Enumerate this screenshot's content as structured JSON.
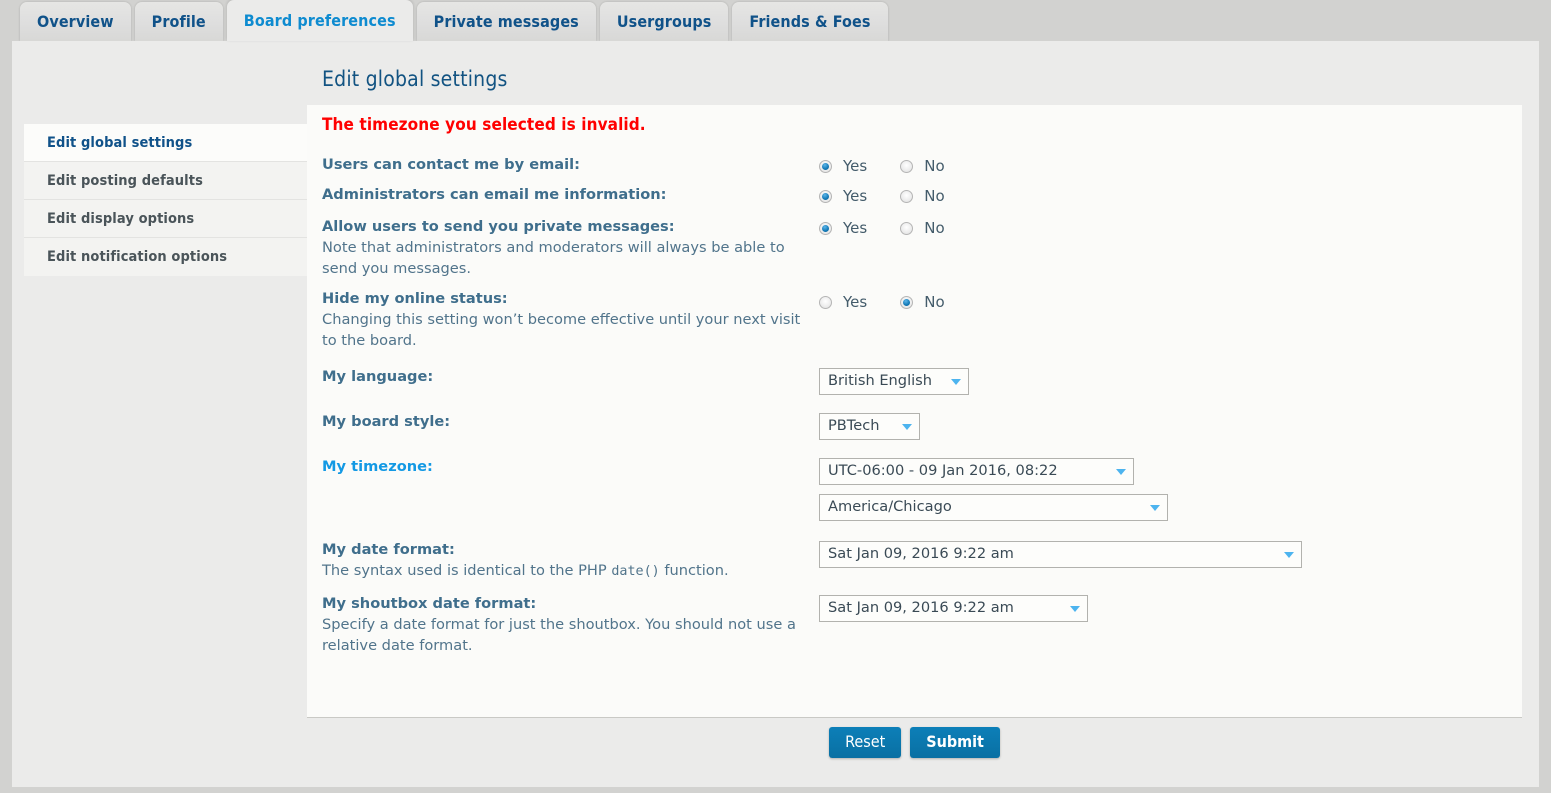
{
  "tabs": [
    {
      "label": "Overview",
      "active": false
    },
    {
      "label": "Profile",
      "active": false
    },
    {
      "label": "Board preferences",
      "active": true
    },
    {
      "label": "Private messages",
      "active": false
    },
    {
      "label": "Usergroups",
      "active": false
    },
    {
      "label": "Friends & Foes",
      "active": false
    }
  ],
  "page": {
    "title": "Edit global settings",
    "error": "The timezone you selected is invalid."
  },
  "sidebar": {
    "items": [
      {
        "label": "Edit global settings",
        "active": true
      },
      {
        "label": "Edit posting defaults",
        "active": false
      },
      {
        "label": "Edit display options",
        "active": false
      },
      {
        "label": "Edit notification options",
        "active": false
      }
    ]
  },
  "form": {
    "yes_label": "Yes",
    "no_label": "No",
    "contact_by_email": {
      "label": "Users can contact me by email:",
      "value": "Yes"
    },
    "admin_email": {
      "label": "Administrators can email me information:",
      "value": "Yes"
    },
    "allow_pm": {
      "label": "Allow users to send you private messages:",
      "desc": "Note that administrators and moderators will always be able to send you messages.",
      "value": "Yes"
    },
    "hide_online": {
      "label": "Hide my online status:",
      "desc": "Changing this setting won’t become effective until your next visit to the board.",
      "value": "No"
    },
    "language": {
      "label": "My language:",
      "value": "British English"
    },
    "board_style": {
      "label": "My board style:",
      "value": "PBTech"
    },
    "timezone": {
      "label": "My timezone:",
      "is_error": true,
      "offset_value": "UTC-06:00 - 09 Jan 2016, 08:22",
      "zone_value": "America/Chicago"
    },
    "date_format": {
      "label": "My date format:",
      "desc_pre": "The syntax used is identical to the PHP ",
      "desc_code": "date()",
      "desc_post": " function.",
      "value": "Sat Jan 09, 2016 9:22 am"
    },
    "shoutbox_date_format": {
      "label": "My shoutbox date format:",
      "desc": "Specify a date format for just the shoutbox. You should not use a relative date format.",
      "value": "Sat Jan 09, 2016 9:22 am"
    }
  },
  "buttons": {
    "reset": "Reset",
    "submit": "Submit"
  },
  "colors": {
    "page_bg": "#d2d2d0",
    "content_bg": "#ebebea",
    "panel_bg": "#fbfbf9",
    "tab_text": "#105289",
    "tab_active_text": "#0e8bd0",
    "label": "#3f6e8c",
    "error_red": "#ff0000",
    "error_label_blue": "#1399e4",
    "button_blue": "#0a73a7",
    "arrow_blue": "#4db4ef"
  }
}
